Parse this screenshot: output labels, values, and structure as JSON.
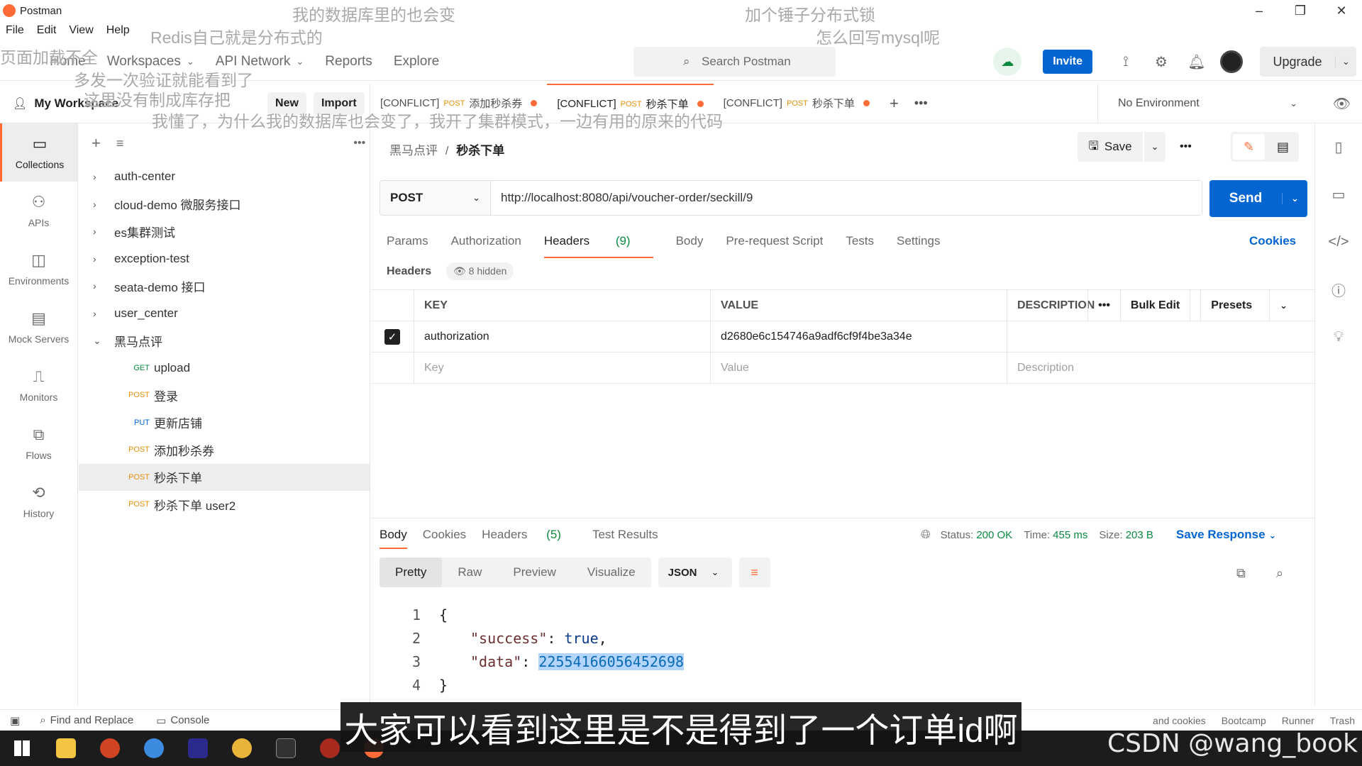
{
  "window": {
    "title": "Postman"
  },
  "menu": [
    "File",
    "Edit",
    "View",
    "Help"
  ],
  "nav": {
    "home": "Home",
    "workspaces": "Workspaces",
    "api_network": "API Network",
    "reports": "Reports",
    "explore": "Explore",
    "search_placeholder": "Search Postman",
    "invite": "Invite",
    "upgrade": "Upgrade"
  },
  "workspace": {
    "name": "My Workspace",
    "new_btn": "New",
    "import_btn": "Import"
  },
  "tabs": [
    {
      "prefix": "[CONFLICT]",
      "method": "POST",
      "name": "添加秒杀券",
      "active": false
    },
    {
      "prefix": "[CONFLICT]",
      "method": "POST",
      "name": "秒杀下单",
      "active": true
    },
    {
      "prefix": "[CONFLICT]",
      "method": "POST",
      "name": "秒杀下单",
      "active": false
    }
  ],
  "environment": "No Environment",
  "left_rail": [
    {
      "label": "Collections",
      "icon": "collections-icon"
    },
    {
      "label": "APIs",
      "icon": "apis-icon"
    },
    {
      "label": "Environments",
      "icon": "environments-icon"
    },
    {
      "label": "Mock Servers",
      "icon": "mock-servers-icon"
    },
    {
      "label": "Monitors",
      "icon": "monitors-icon"
    },
    {
      "label": "Flows",
      "icon": "flows-icon"
    },
    {
      "label": "History",
      "icon": "history-icon"
    }
  ],
  "collections": [
    {
      "name": "auth-center",
      "expanded": false
    },
    {
      "name": "cloud-demo 微服务接口",
      "expanded": false
    },
    {
      "name": "es集群测试",
      "expanded": false
    },
    {
      "name": "exception-test",
      "expanded": false
    },
    {
      "name": "seata-demo 接口",
      "expanded": false
    },
    {
      "name": "user_center",
      "expanded": false
    },
    {
      "name": "黑马点评",
      "expanded": true
    }
  ],
  "requests": [
    {
      "method": "GET",
      "name": "upload"
    },
    {
      "method": "POST",
      "name": "登录"
    },
    {
      "method": "PUT",
      "name": "更新店铺"
    },
    {
      "method": "POST",
      "name": "添加秒杀券"
    },
    {
      "method": "POST",
      "name": "秒杀下单"
    },
    {
      "method": "POST",
      "name": "秒杀下单 user2"
    }
  ],
  "request": {
    "breadcrumb_parent": "黑马点评",
    "breadcrumb_sep": "/",
    "breadcrumb_current": "秒杀下单",
    "save": "Save",
    "method": "POST",
    "url": "http://localhost:8080/api/voucher-order/seckill/9",
    "send": "Send",
    "tabs": {
      "params": "Params",
      "authorization": "Authorization",
      "headers": "Headers",
      "headers_count": "(9)",
      "body": "Body",
      "prerequest": "Pre-request Script",
      "tests": "Tests",
      "settings": "Settings"
    },
    "cookies": "Cookies",
    "headers_label": "Headers",
    "hidden_badge": "8 hidden",
    "table": {
      "col_key": "KEY",
      "col_value": "VALUE",
      "col_desc": "DESCRIPTION",
      "bulk_edit": "Bulk Edit",
      "presets": "Presets",
      "rows": [
        {
          "key": "authorization",
          "value": "d2680e6c154746a9adf6cf9f4be3a34e",
          "checked": true
        }
      ],
      "placeholder_key": "Key",
      "placeholder_value": "Value",
      "placeholder_desc": "Description"
    }
  },
  "response": {
    "tabs": {
      "body": "Body",
      "cookies": "Cookies",
      "headers": "Headers",
      "headers_count": "(5)",
      "test_results": "Test Results"
    },
    "status_label": "Status:",
    "status": "200 OK",
    "time_label": "Time:",
    "time": "455 ms",
    "size_label": "Size:",
    "size": "203 B",
    "save_response": "Save Response",
    "format_tabs": [
      "Pretty",
      "Raw",
      "Preview",
      "Visualize"
    ],
    "format": "JSON",
    "code": {
      "l1_num": "1",
      "l1": "{",
      "l2_num": "2",
      "l2_key": "\"success\"",
      "l2_colon": ": ",
      "l2_val": "true",
      "l3_num": "3",
      "l3_key": "\"data\"",
      "l3_colon": ": ",
      "l3_val": "225541660564526​98",
      "l4_num": "4",
      "l4": "}"
    }
  },
  "statusbar": {
    "find_replace": "Find and Replace",
    "console": "Console",
    "right": [
      "and cookies",
      "Bootcamp",
      "Runner",
      "Trash"
    ]
  },
  "overlays": {
    "o1": "我的数据库里的也会变",
    "o2": "加个锤子分布式锁",
    "o3": "Redis自己就是分布式的",
    "o4": "怎么回写mysql呢",
    "o5": "页面加载不全",
    "o6": "多发一次验证就能看到了",
    "o7": "这里没有制成库存把",
    "o8": "我懂了，为什么我的数据库也会变了，我开了集群模式，一边有用的原来的代码"
  },
  "subtitle": "大家可以看到这里是不是得到了一个订单id啊",
  "watermark": "CSDN @wang_book"
}
